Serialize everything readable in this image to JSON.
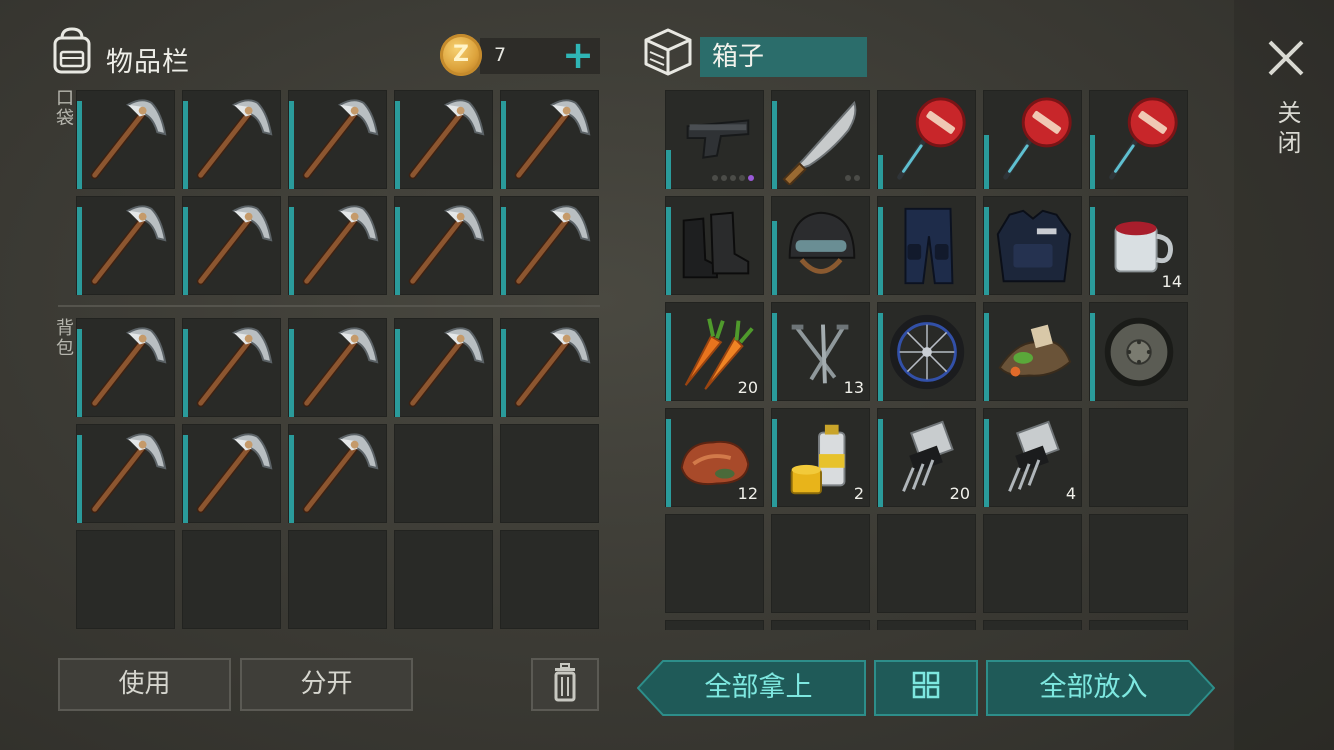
{
  "inventory": {
    "title": "物品栏",
    "pocket_label": "口袋",
    "backpack_label": "背包",
    "coins": "7",
    "coin_symbol": "Z",
    "plus": "+"
  },
  "box": {
    "title": "箱子",
    "close_label": "关闭"
  },
  "pocket_slots": [
    {
      "item": "pickaxe-icon"
    },
    {
      "item": "pickaxe-icon"
    },
    {
      "item": "pickaxe-icon"
    },
    {
      "item": "pickaxe-icon"
    },
    {
      "item": "pickaxe-icon"
    },
    {
      "item": "pickaxe-icon"
    },
    {
      "item": "pickaxe-icon"
    },
    {
      "item": "pickaxe-icon"
    },
    {
      "item": "pickaxe-icon"
    },
    {
      "item": "pickaxe-icon"
    }
  ],
  "backpack_slots": [
    {
      "item": "pickaxe-icon"
    },
    {
      "item": "pickaxe-icon"
    },
    {
      "item": "pickaxe-icon"
    },
    {
      "item": "pickaxe-icon"
    },
    {
      "item": "pickaxe-icon"
    },
    {
      "item": "pickaxe-icon"
    },
    {
      "item": "pickaxe-icon"
    },
    {
      "item": "pickaxe-icon"
    },
    {
      "item": null
    },
    {
      "item": null
    },
    {
      "item": null
    },
    {
      "item": null
    },
    {
      "item": null
    },
    {
      "item": null
    },
    {
      "item": null
    }
  ],
  "box_slots": [
    {
      "item": "pistol-icon",
      "durability": 0.4
    },
    {
      "item": "machete-icon",
      "durability": 0.9
    },
    {
      "item": "stop-sign-icon",
      "durability": 0.35
    },
    {
      "item": "stop-sign-icon",
      "durability": 0.55
    },
    {
      "item": "stop-sign-icon",
      "durability": 0.55
    },
    {
      "item": "boots-icon",
      "durability": 0.9
    },
    {
      "item": "helmet-icon",
      "durability": 0.75
    },
    {
      "item": "pants-icon",
      "durability": 0.9
    },
    {
      "item": "vest-icon",
      "durability": 0.9
    },
    {
      "item": "mug-icon",
      "count": "14"
    },
    {
      "item": "carrot-icon",
      "count": "20"
    },
    {
      "item": "nails-icon",
      "count": "13"
    },
    {
      "item": "wheel-icon"
    },
    {
      "item": "scrap-icon"
    },
    {
      "item": "disc-icon"
    },
    {
      "item": "raw-meat-icon",
      "count": "12"
    },
    {
      "item": "spray-paint-icon",
      "count": "2"
    },
    {
      "item": "transistor-icon",
      "count": "20"
    },
    {
      "item": "transistor-icon",
      "count": "4"
    }
  ],
  "buttons": {
    "use": "使用",
    "split": "分开",
    "take_all": "全部拿上",
    "put_all": "全部放入"
  },
  "colors": {
    "accent": "#2a9b9b",
    "button_teal": "#2b6d6b",
    "button_text": "#7ee8e0"
  }
}
